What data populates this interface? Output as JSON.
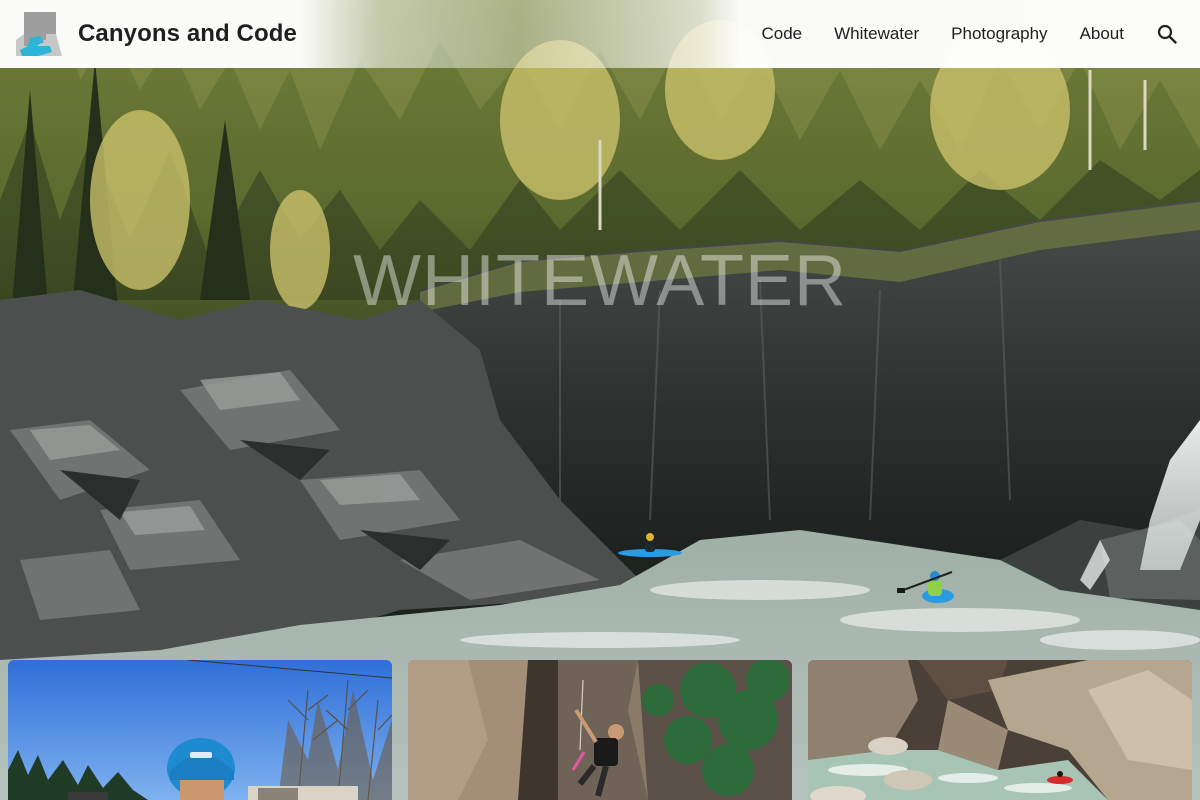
{
  "site": {
    "title": "Canyons and Code",
    "logo_icon": "canyon-river-logo-icon"
  },
  "nav": {
    "items": [
      {
        "label": "Code"
      },
      {
        "label": "Whitewater"
      },
      {
        "label": "Photography"
      },
      {
        "label": "About"
      }
    ],
    "search_icon": "search-icon"
  },
  "hero": {
    "title": "WHITEWATER"
  },
  "colors": {
    "brand_blue": "#29b6d9",
    "logo_gray": "#9e9e9e",
    "text_dark": "#1f1f1f",
    "river": "#a7b5ad"
  },
  "cards": [
    {
      "name": "card-kayaker-helmet"
    },
    {
      "name": "card-climber-canyon"
    },
    {
      "name": "card-kayak-river-canyon"
    }
  ]
}
